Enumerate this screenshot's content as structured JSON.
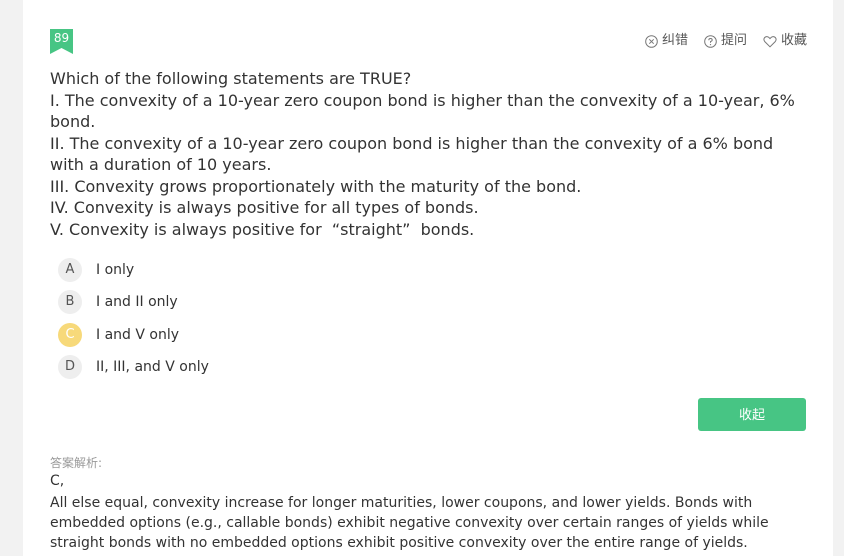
{
  "question_number": "89",
  "actions": [
    {
      "label": "纠错",
      "icon": "error-report-icon"
    },
    {
      "label": "提问",
      "icon": "question-icon"
    },
    {
      "label": "收藏",
      "icon": "heart-icon"
    }
  ],
  "question_lines": [
    "Which of the following statements are TRUE?",
    "I. The convexity of a 10-year zero coupon bond is higher than the convexity of a 10-year, 6% bond.",
    "II. The convexity of a 10-year zero coupon bond is higher than the convexity of a 6% bond with a duration of 10 years.",
    "III. Convexity grows proportionately with the maturity of the bond.",
    "IV. Convexity is always positive for all types of bonds.",
    "V. Convexity is always positive for  “straight”  bonds."
  ],
  "options": [
    {
      "letter": "A",
      "text": "I only",
      "selected": false
    },
    {
      "letter": "B",
      "text": "I and II only",
      "selected": false
    },
    {
      "letter": "C",
      "text": "I and V only",
      "selected": true
    },
    {
      "letter": "D",
      "text": "II, III, and V only",
      "selected": false
    }
  ],
  "collapse_label": "收起",
  "analysis_label": "答案解析:",
  "answer": "C,",
  "explanation": "All else equal, convexity increase for longer maturities, lower coupons, and lower yields. Bonds with embedded options (e.g., callable bonds) exhibit negative convexity over certain ranges of yields while straight bonds with no embedded options exhibit positive convexity over the entire range of yields.",
  "colors": {
    "badge": "#47c584",
    "collapse_button": "#47c584",
    "selected_option": "#f7d97a",
    "option_circle": "#eeeeee"
  }
}
